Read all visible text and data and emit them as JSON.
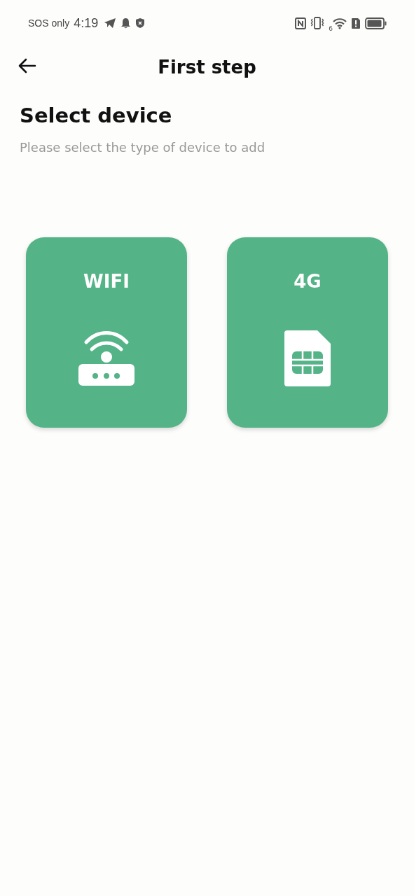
{
  "status_bar": {
    "carrier": "SOS only",
    "time": "4:19",
    "wifi_badge": "6"
  },
  "header": {
    "title": "First step"
  },
  "heading": "Select device",
  "subtitle": "Please select the type of device to add",
  "devices": [
    {
      "label": "WIFI",
      "kind": "router"
    },
    {
      "label": "4G",
      "kind": "sim"
    }
  ]
}
